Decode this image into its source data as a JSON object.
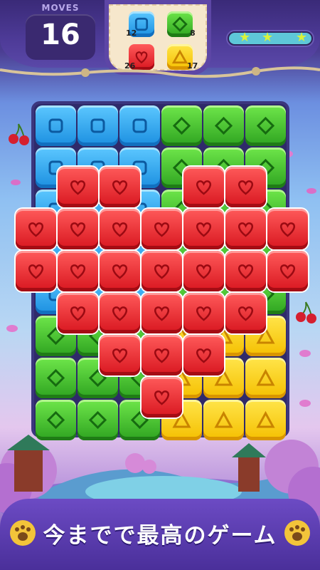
{
  "moves": {
    "label": "MOVES",
    "value": "16"
  },
  "goals": [
    {
      "color": "#1b8fe0",
      "shape": "square",
      "count": "12",
      "name": "blue-square"
    },
    {
      "color": "#2ea320",
      "shape": "diamond",
      "count": "8",
      "name": "green-diamond"
    },
    {
      "color": "#d8161f",
      "shape": "heart",
      "count": "26",
      "name": "red-heart"
    },
    {
      "color": "#f5bf00",
      "shape": "triangle",
      "count": "17",
      "name": "yellow-triangle"
    }
  ],
  "progress": {
    "fraction": 1.0,
    "stars_earned": 3,
    "stars_total": 3
  },
  "board": {
    "cols": 6,
    "rows": 8,
    "cells": [
      [
        "blue",
        "blue",
        "blue",
        "green",
        "green",
        "green"
      ],
      [
        "blue",
        "blue",
        "blue",
        "green",
        "green",
        "green"
      ],
      [
        "blue",
        "blue",
        "blue",
        "green",
        "green",
        "green"
      ],
      [
        "blue",
        "blue",
        "blue",
        "green",
        "green",
        "green"
      ],
      [
        "blue",
        "blue",
        "blue",
        "green",
        "green",
        "green"
      ],
      [
        "green",
        "green",
        "green",
        "yellow",
        "yellow",
        "yellow"
      ],
      [
        "green",
        "green",
        "green",
        "yellow",
        "yellow",
        "yellow"
      ],
      [
        "green",
        "green",
        "green",
        "yellow",
        "yellow",
        "yellow"
      ]
    ],
    "heart_overlay": [
      [
        0,
        1,
        1,
        0,
        1,
        1,
        0
      ],
      [
        1,
        1,
        1,
        1,
        1,
        1,
        1
      ],
      [
        1,
        1,
        1,
        1,
        1,
        1,
        1
      ],
      [
        0,
        1,
        1,
        1,
        1,
        1,
        0
      ],
      [
        0,
        0,
        1,
        1,
        1,
        0,
        0
      ],
      [
        0,
        0,
        0,
        1,
        0,
        0,
        0
      ]
    ]
  },
  "banner": {
    "text": "今までで最高のゲーム"
  },
  "colors": {
    "blue": "#1b8fe0",
    "green": "#2ea320",
    "yellow": "#f5bf00",
    "red": "#d8161f",
    "accent": "#5ec7d8"
  }
}
